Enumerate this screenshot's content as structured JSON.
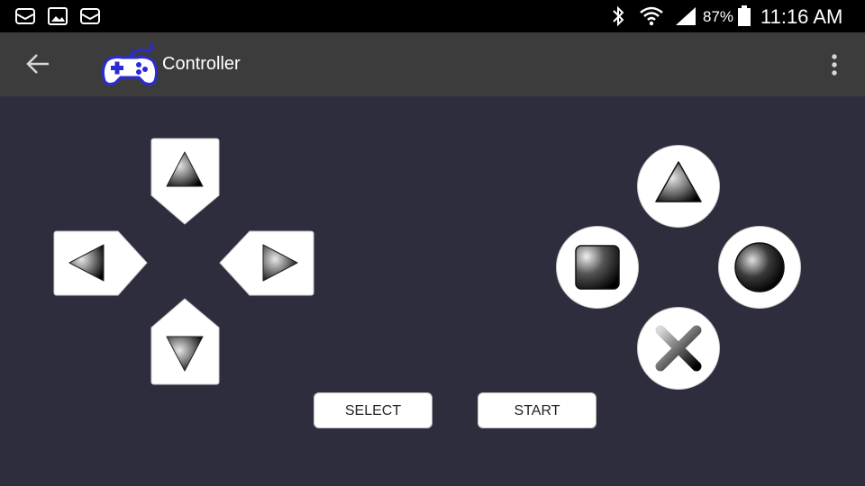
{
  "status_bar": {
    "battery_percent": "87%",
    "time": "11:16 AM",
    "left_icons": [
      "mail-icon",
      "image-icon",
      "mail-icon"
    ],
    "right_icons": [
      "bluetooth-icon",
      "wifi-icon",
      "signal-icon",
      "battery-icon"
    ]
  },
  "app_bar": {
    "title": "Controller",
    "icons": [
      "back-arrow-icon",
      "gamepad-logo-icon",
      "overflow-menu-icon"
    ]
  },
  "dpad": {
    "buttons": [
      "up",
      "left",
      "right",
      "down"
    ]
  },
  "face_buttons": [
    "triangle",
    "square",
    "circle",
    "cross"
  ],
  "buttons": {
    "select_label": "SELECT",
    "start_label": "START"
  },
  "colors": {
    "status_bar_bg": "#000000",
    "app_bar_bg": "#3c3c3c",
    "content_bg": "#2e2d3d",
    "logo_accent": "#2b2bd6"
  }
}
